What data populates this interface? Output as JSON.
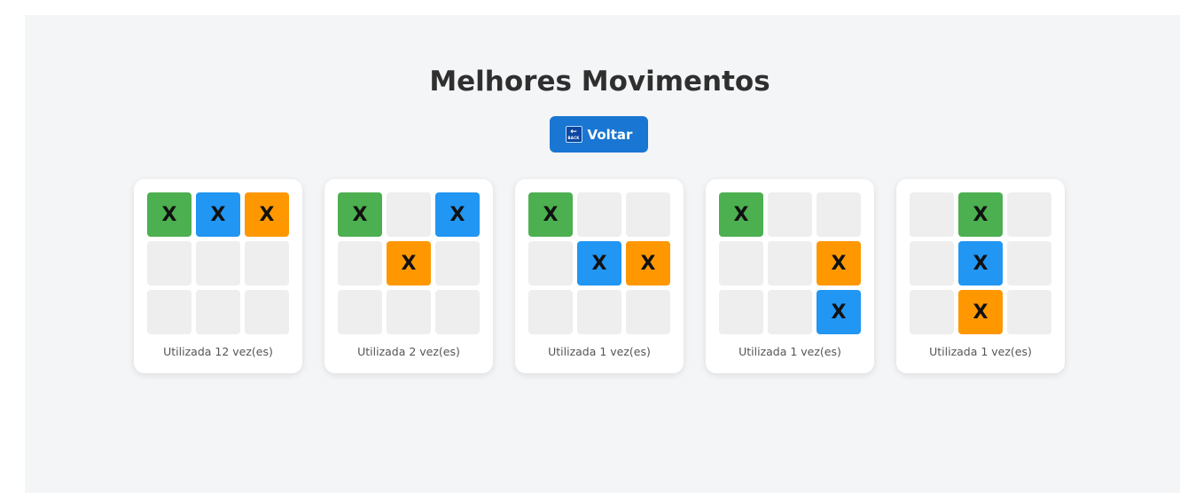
{
  "header": {
    "title": "Melhores Movimentos",
    "back_label": "Voltar",
    "back_icon": "back-arrow-icon"
  },
  "colors": {
    "green": "#4caf50",
    "blue": "#2196f3",
    "orange": "#ff9800",
    "empty": "#eeeeee",
    "button": "#1976d2"
  },
  "boards": [
    {
      "caption": "Utilizada 12 vez(es)",
      "cells": [
        {
          "mark": "X",
          "color": "green"
        },
        {
          "mark": "X",
          "color": "blue"
        },
        {
          "mark": "X",
          "color": "orange"
        },
        {
          "mark": "",
          "color": ""
        },
        {
          "mark": "",
          "color": ""
        },
        {
          "mark": "",
          "color": ""
        },
        {
          "mark": "",
          "color": ""
        },
        {
          "mark": "",
          "color": ""
        },
        {
          "mark": "",
          "color": ""
        }
      ]
    },
    {
      "caption": "Utilizada 2 vez(es)",
      "cells": [
        {
          "mark": "X",
          "color": "green"
        },
        {
          "mark": "",
          "color": ""
        },
        {
          "mark": "X",
          "color": "blue"
        },
        {
          "mark": "",
          "color": ""
        },
        {
          "mark": "X",
          "color": "orange"
        },
        {
          "mark": "",
          "color": ""
        },
        {
          "mark": "",
          "color": ""
        },
        {
          "mark": "",
          "color": ""
        },
        {
          "mark": "",
          "color": ""
        }
      ]
    },
    {
      "caption": "Utilizada 1 vez(es)",
      "cells": [
        {
          "mark": "X",
          "color": "green"
        },
        {
          "mark": "",
          "color": ""
        },
        {
          "mark": "",
          "color": ""
        },
        {
          "mark": "",
          "color": ""
        },
        {
          "mark": "X",
          "color": "blue"
        },
        {
          "mark": "X",
          "color": "orange"
        },
        {
          "mark": "",
          "color": ""
        },
        {
          "mark": "",
          "color": ""
        },
        {
          "mark": "",
          "color": ""
        }
      ]
    },
    {
      "caption": "Utilizada 1 vez(es)",
      "cells": [
        {
          "mark": "X",
          "color": "green"
        },
        {
          "mark": "",
          "color": ""
        },
        {
          "mark": "",
          "color": ""
        },
        {
          "mark": "",
          "color": ""
        },
        {
          "mark": "",
          "color": ""
        },
        {
          "mark": "X",
          "color": "orange"
        },
        {
          "mark": "",
          "color": ""
        },
        {
          "mark": "",
          "color": ""
        },
        {
          "mark": "X",
          "color": "blue"
        }
      ]
    },
    {
      "caption": "Utilizada 1 vez(es)",
      "cells": [
        {
          "mark": "",
          "color": ""
        },
        {
          "mark": "X",
          "color": "green"
        },
        {
          "mark": "",
          "color": ""
        },
        {
          "mark": "",
          "color": ""
        },
        {
          "mark": "X",
          "color": "blue"
        },
        {
          "mark": "",
          "color": ""
        },
        {
          "mark": "",
          "color": ""
        },
        {
          "mark": "X",
          "color": "orange"
        },
        {
          "mark": "",
          "color": ""
        }
      ]
    }
  ]
}
